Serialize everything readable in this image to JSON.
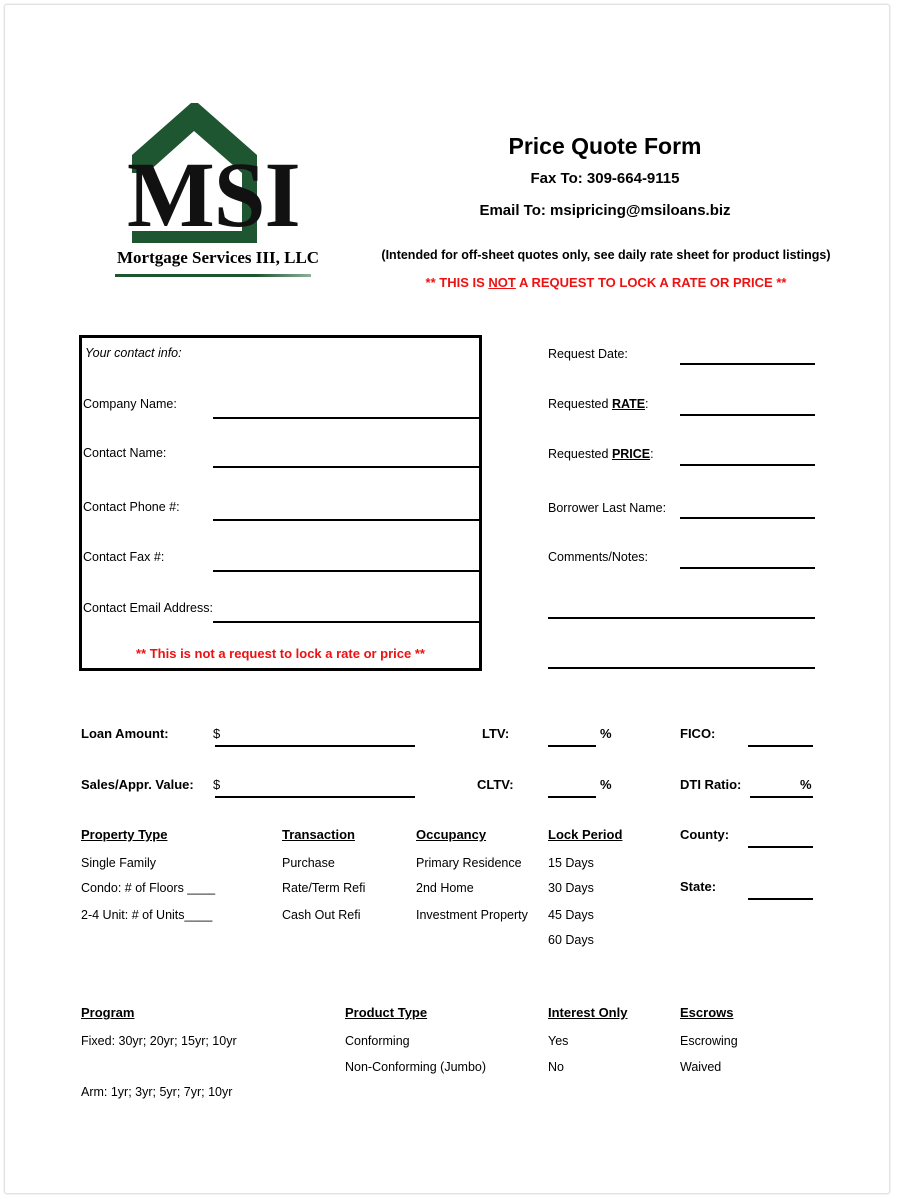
{
  "document": {
    "title": "Price Quote Form",
    "company": {
      "logo_mark": "house-roof-logo",
      "abbrev": "MSI",
      "name": "Mortgage Services III, LLC"
    },
    "header": {
      "title": "Price Quote Form",
      "fax_to": "Fax To:  309-664-9115",
      "email_to": "Email To:  msipricing@msiloans.biz",
      "note": "(Intended for off-sheet quotes only, see daily rate sheet for product listings)",
      "warning_pre": "**  THIS IS ",
      "warning_not": "NOT",
      "warning_post": " A REQUEST TO LOCK A RATE OR PRICE **"
    },
    "contact_box": {
      "heading": "Your contact info:",
      "fields": [
        {
          "label": "Company Name:",
          "value": ""
        },
        {
          "label": "Contact Name:",
          "value": ""
        },
        {
          "label": "Contact Phone #:",
          "value": ""
        },
        {
          "label": "Contact Fax #:",
          "value": ""
        },
        {
          "label": "Contact Email Address:",
          "value": ""
        }
      ],
      "footer_warning": "** This is not a request to lock a rate or price **"
    },
    "request_fields": [
      {
        "label": "Request Date:",
        "value": ""
      },
      {
        "label_pre": "Requested ",
        "label_strong": "RATE",
        "label_post": ":",
        "value": ""
      },
      {
        "label_pre": "Requested ",
        "label_strong": "PRICE",
        "label_post": ":",
        "value": ""
      },
      {
        "label": "Borrower Last Name:",
        "value": ""
      },
      {
        "label": "Comments/Notes:",
        "value": ""
      }
    ],
    "comment_lines": [
      "",
      ""
    ],
    "amount_rows": [
      {
        "label": "Loan Amount:",
        "currency": "$",
        "value": "",
        "mid_label": "LTV:",
        "mid_value": "",
        "mid_suffix": "%",
        "right_label": "FICO:",
        "right_value": "",
        "right_suffix": ""
      },
      {
        "label": "Sales/Appr. Value:",
        "currency": "$",
        "value": "",
        "mid_label": "CLTV:",
        "mid_value": "",
        "mid_suffix": "%",
        "right_label": "DTI Ratio:",
        "right_value": "",
        "right_suffix": "%"
      }
    ],
    "option_columns": [
      {
        "heading": "Property Type",
        "items": [
          "Single Family",
          "Condo: # of Floors ____",
          "2-4 Unit: # of Units____"
        ]
      },
      {
        "heading": "Transaction",
        "items": [
          "Purchase",
          "Rate/Term Refi",
          "Cash Out Refi"
        ]
      },
      {
        "heading": "Occupancy",
        "items": [
          "Primary Residence",
          "2nd Home",
          "Investment Property"
        ]
      },
      {
        "heading": "Lock Period",
        "items": [
          "15 Days",
          "30 Days",
          "45 Days",
          "60 Days"
        ]
      }
    ],
    "location_fields": [
      {
        "label": "County:",
        "value": ""
      },
      {
        "label": "State:",
        "value": ""
      }
    ],
    "bottom_columns": [
      {
        "heading": "Program",
        "items": [
          "Fixed:  30yr;  20yr;  15yr;  10yr",
          "Arm:  1yr;  3yr;  5yr;  7yr;  10yr"
        ]
      },
      {
        "heading": "Product Type",
        "items": [
          "Conforming",
          "Non-Conforming (Jumbo)"
        ]
      },
      {
        "heading": "Interest Only",
        "items": [
          "Yes",
          "No"
        ]
      },
      {
        "heading": "Escrows",
        "items": [
          "Escrowing",
          "Waived"
        ]
      }
    ],
    "colors": {
      "logo_green": "#1e5631",
      "warning_red": "#ee1111",
      "ink": "#000000"
    }
  }
}
